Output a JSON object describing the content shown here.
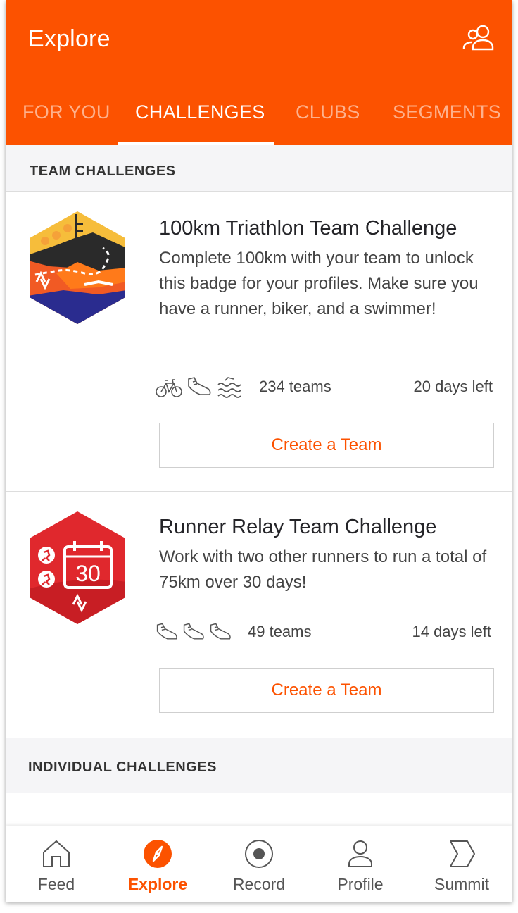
{
  "header": {
    "title": "Explore",
    "people_icon": "people-icon",
    "tabs": [
      {
        "label": "FOR YOU",
        "active": false
      },
      {
        "label": "CHALLENGES",
        "active": true
      },
      {
        "label": "CLUBS",
        "active": false
      },
      {
        "label": "SEGMENTS",
        "active": false
      }
    ]
  },
  "sections": {
    "team": "TEAM CHALLENGES",
    "individual": "INDIVIDUAL CHALLENGES"
  },
  "challenges": [
    {
      "title": "100km Triathlon Team Challenge",
      "description": "Complete 100km with your team to unlock this badge for your profiles. Make sure you have a runner, biker, and a swimmer!",
      "sports": [
        "bike-icon",
        "shoe-icon",
        "swim-icon"
      ],
      "teams": "234 teams",
      "days_left": "20 days left",
      "button": "Create a Team"
    },
    {
      "title": "Runner Relay Team Challenge",
      "description": "Work with two other runners to run a total of 75km over 30 days!",
      "sports": [
        "shoe-icon",
        "shoe-icon",
        "shoe-icon"
      ],
      "teams": "49 teams",
      "days_left": "14 days left",
      "button": "Create a Team",
      "badge_number": "30"
    }
  ],
  "bottom_nav": [
    {
      "label": "Feed",
      "icon": "home-icon",
      "active": false
    },
    {
      "label": "Explore",
      "icon": "compass-icon",
      "active": true
    },
    {
      "label": "Record",
      "icon": "record-icon",
      "active": false
    },
    {
      "label": "Profile",
      "icon": "person-icon",
      "active": false
    },
    {
      "label": "Summit",
      "icon": "summit-icon",
      "active": false
    }
  ],
  "colors": {
    "accent": "#fc5200",
    "badge_red": "#e0282d",
    "badge_yellow": "#f6bd3b",
    "badge_navy": "#2a2c8f"
  }
}
